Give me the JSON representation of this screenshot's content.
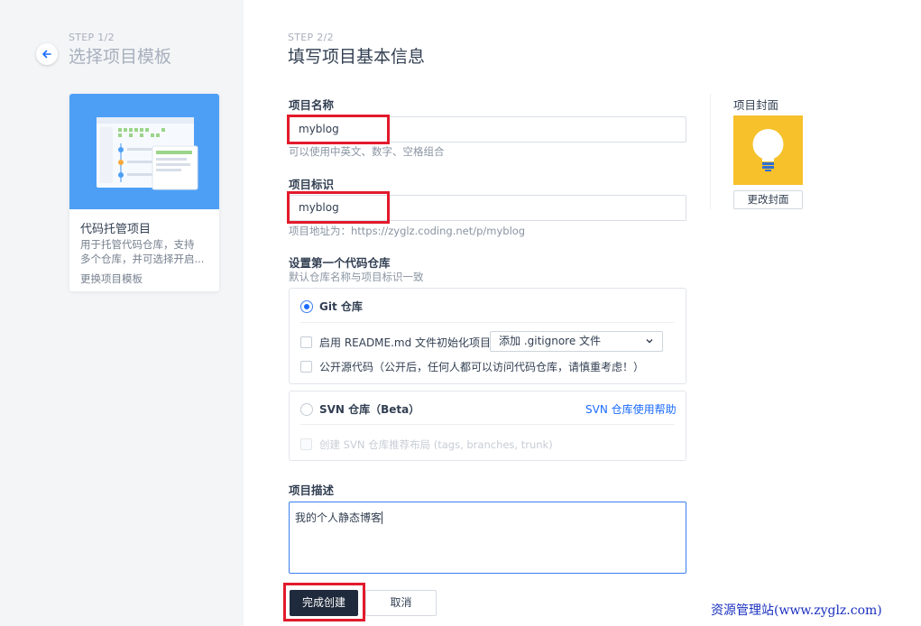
{
  "left_panel": {
    "step_label": "STEP 1/2",
    "step_title": "选择项目模板",
    "template_card": {
      "title": "代码托管项目",
      "description_line1": "用于托管代码仓库，支持",
      "description_line2": "多个仓库，并可选择开启...",
      "change_link": "更换项目模板"
    }
  },
  "form": {
    "step_label": "STEP 2/2",
    "step_title": "填写项目基本信息",
    "project_name": {
      "label": "项目名称",
      "value": "myblog",
      "hint": "可以使用中英文、数字、空格组合"
    },
    "project_id": {
      "label": "项目标识",
      "value": "myblog",
      "hint": "项目地址为：https://zyglz.coding.net/p/myblog"
    },
    "repo_section": {
      "label": "设置第一个代码仓库",
      "hint": "默认仓库名称与项目标识一致",
      "git_option": {
        "label": "Git 仓库",
        "selected": true,
        "readme_checkbox": "启用 README.md 文件初始化项目",
        "gitignore_select": "添加 .gitignore 文件",
        "opensource_checkbox": "公开源代码（公开后，任何人都可以访问代码仓库，请慎重考虑！）"
      },
      "svn_option": {
        "label": "SVN 仓库（Beta）",
        "help_link": "SVN 仓库使用帮助",
        "layout_checkbox": "创建 SVN 仓库推荐布局 (tags, branches, trunk)"
      }
    },
    "description": {
      "label": "项目描述",
      "value": "我的个人静态博客"
    },
    "submit_label": "完成创建",
    "cancel_label": "取消"
  },
  "cover": {
    "label": "项目封面",
    "change_label": "更改封面",
    "bg_color": "#f6c12b",
    "icon": "lightbulb-icon"
  },
  "watermark": "资源管理站(www.zyglz.com)",
  "colors": {
    "accent": "#1a6bff",
    "highlight_red": "#e21a2c",
    "primary_button": "#1f2a3c"
  }
}
